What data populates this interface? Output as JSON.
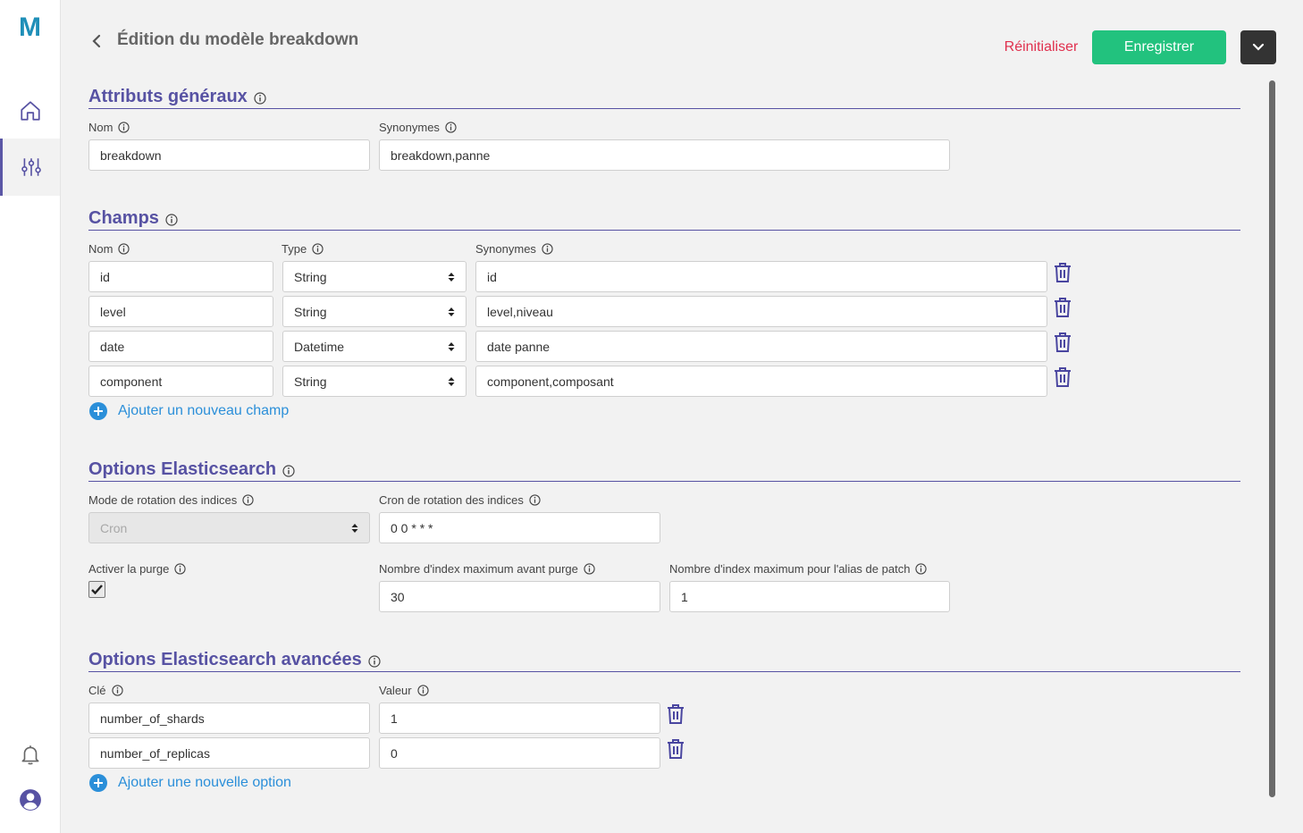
{
  "page": {
    "title": "Édition du modèle breakdown"
  },
  "toolbar": {
    "reset_label": "Réinitialiser",
    "save_label": "Enregistrer"
  },
  "sidebar": {
    "logo": "M",
    "items": [
      {
        "name": "home",
        "icon": "home-icon"
      },
      {
        "name": "settings",
        "icon": "sliders-icon",
        "active": true
      }
    ],
    "bottom": [
      {
        "name": "notifications",
        "icon": "bell-icon"
      },
      {
        "name": "account",
        "icon": "user-icon"
      }
    ]
  },
  "general": {
    "title": "Attributs généraux",
    "name_label": "Nom",
    "name_value": "breakdown",
    "synonyms_label": "Synonymes",
    "synonyms_value": "breakdown,panne"
  },
  "fields": {
    "title": "Champs",
    "col_name": "Nom",
    "col_type": "Type",
    "col_synonyms": "Synonymes",
    "rows": [
      {
        "name": "id",
        "type": "String",
        "synonyms": "id"
      },
      {
        "name": "level",
        "type": "String",
        "synonyms": "level,niveau"
      },
      {
        "name": "date",
        "type": "Datetime",
        "synonyms": "date panne"
      },
      {
        "name": "component",
        "type": "String",
        "synonyms": "component,composant"
      }
    ],
    "add_label": "Ajouter un nouveau champ"
  },
  "es": {
    "title": "Options Elasticsearch",
    "rotation_mode_label": "Mode de rotation des indices",
    "rotation_mode_value": "Cron",
    "rotation_cron_label": "Cron de rotation des indices",
    "rotation_cron_value": "0 0 * * *",
    "purge_label": "Activer la purge",
    "purge_checked": true,
    "max_index_label": "Nombre d'index maximum avant purge",
    "max_index_value": "30",
    "max_alias_label": "Nombre d'index maximum pour l'alias de patch",
    "max_alias_value": "1"
  },
  "es_adv": {
    "title": "Options Elasticsearch avancées",
    "key_label": "Clé",
    "value_label": "Valeur",
    "rows": [
      {
        "key": "number_of_shards",
        "value": "1"
      },
      {
        "key": "number_of_replicas",
        "value": "0"
      }
    ],
    "add_label": "Ajouter une nouvelle option"
  },
  "colors": {
    "accent": "#5752a3",
    "save": "#22c27e",
    "reset": "#e0304e",
    "link": "#2b8fd9",
    "trash": "#4a46a0"
  }
}
